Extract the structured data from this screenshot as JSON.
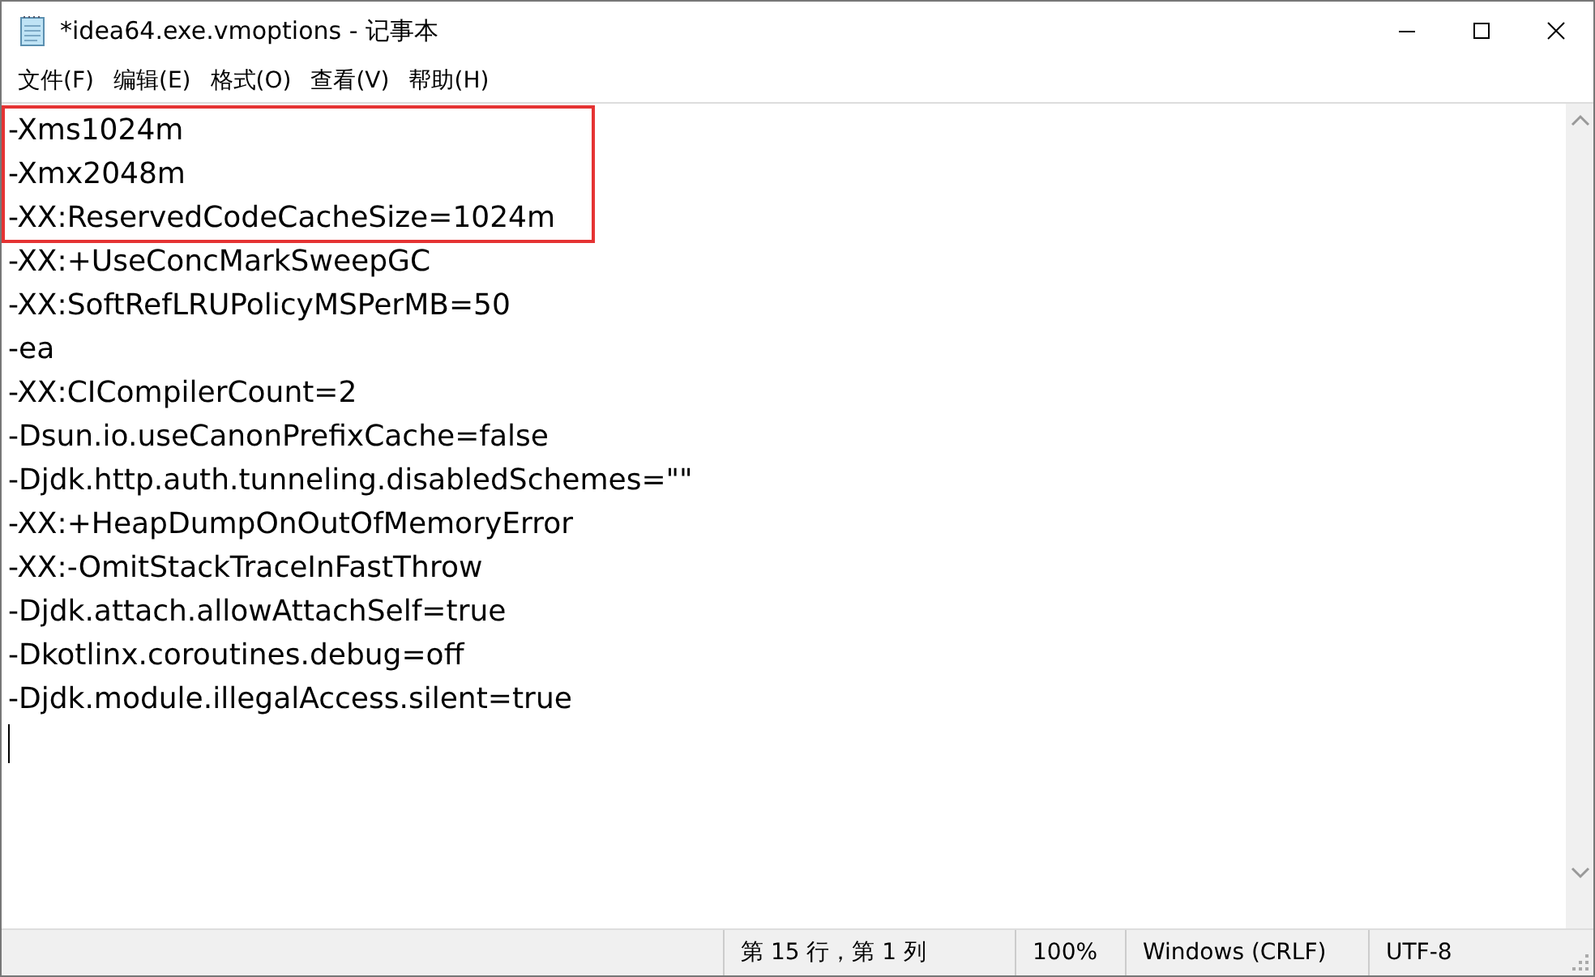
{
  "window": {
    "title": "*idea64.exe.vmoptions - 记事本"
  },
  "menu": [
    {
      "label": "文件(F)"
    },
    {
      "label": "编辑(E)"
    },
    {
      "label": "格式(O)"
    },
    {
      "label": "查看(V)"
    },
    {
      "label": "帮助(H)"
    }
  ],
  "editor": {
    "highlighted_lines": [
      "-Xms1024m",
      "-Xmx2048m",
      "-XX:ReservedCodeCacheSize=1024m"
    ],
    "lines": [
      "-XX:+UseConcMarkSweepGC",
      "-XX:SoftRefLRUPolicyMSPerMB=50",
      "-ea",
      "-XX:CICompilerCount=2",
      "-Dsun.io.useCanonPrefixCache=false",
      "-Djdk.http.auth.tunneling.disabledSchemes=\"\"",
      "-XX:+HeapDumpOnOutOfMemoryError",
      "-XX:-OmitStackTraceInFastThrow",
      "-Djdk.attach.allowAttachSelf=true",
      "-Dkotlinx.coroutines.debug=off",
      "-Djdk.module.illegalAccess.silent=true"
    ]
  },
  "status_bar": [
    "第 15 行，第 1 列",
    "100%",
    "Windows (CRLF)",
    "UTF-8"
  ]
}
